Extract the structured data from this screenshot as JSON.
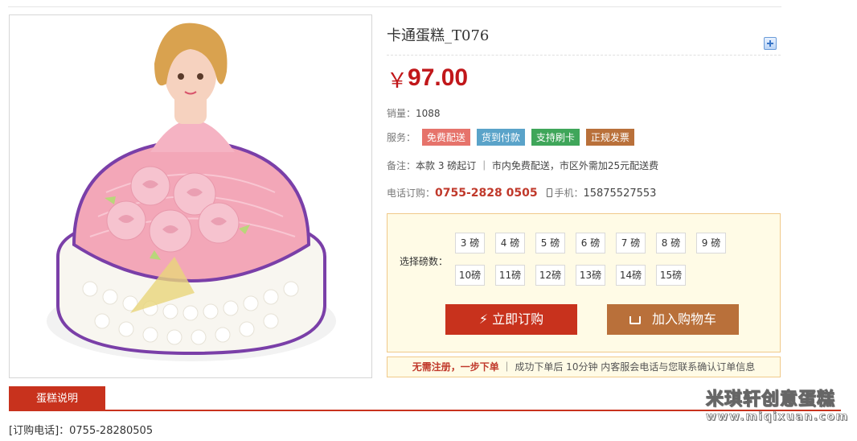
{
  "product": {
    "title": "卡通蛋糕_T076",
    "currency": "￥",
    "price": "97.00"
  },
  "sales": {
    "label": "销量：",
    "value": "1088"
  },
  "service": {
    "label": "服务：",
    "tags": [
      {
        "text": "免费配送",
        "color": "#e6736b"
      },
      {
        "text": "货到付款",
        "color": "#5aa3c9"
      },
      {
        "text": "支持刷卡",
        "color": "#3fa65a"
      },
      {
        "text": "正规发票",
        "color": "#b9703a"
      }
    ]
  },
  "remark": {
    "label": "备注：",
    "text": "本款 3 磅起订 ｜ 市内免费配送，市区外需加25元配送费"
  },
  "order_phone": {
    "label": "电话订购：",
    "number": "0755-2828 0505",
    "mobile_label": "手机：",
    "mobile": "15875527553"
  },
  "weight": {
    "label": "选择磅数：",
    "options_row1": [
      "3 磅",
      "4 磅",
      "5 磅",
      "6 磅",
      "7 磅",
      "8 磅",
      "9 磅"
    ],
    "options_row2": [
      "10磅",
      "11磅",
      "12磅",
      "13磅",
      "14磅",
      "15磅"
    ]
  },
  "buttons": {
    "buy_now": "⚡  立即订购",
    "add_cart": "加入购物车"
  },
  "note": {
    "highlight": "无需注册，一步下单",
    "text": " ｜ 成功下单后 10分钟 内客服会电话与您联系确认订单信息"
  },
  "tab": {
    "label": "蛋糕说明"
  },
  "contact": {
    "text": "[订购电话]：0755-28280505"
  },
  "watermark": {
    "brand": "米琪轩创意蛋糕",
    "url": "www.miqixuan.com"
  },
  "colors": {
    "accent": "#c8321d",
    "price": "#c1171a",
    "panel_bg": "#fffbe6",
    "panel_border": "#f0c98a"
  }
}
